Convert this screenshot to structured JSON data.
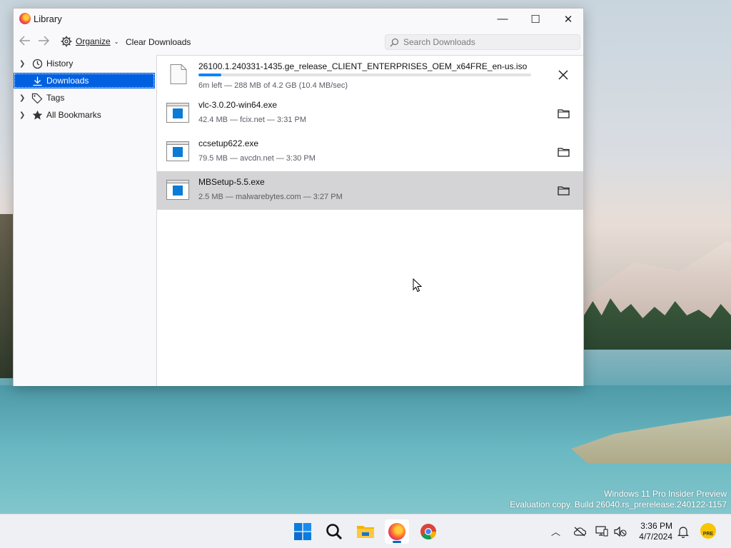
{
  "window": {
    "title": "Library",
    "minimize_glyph": "—",
    "maximize_glyph": "☐",
    "close_glyph": "✕"
  },
  "toolbar": {
    "organize_label": "Organize",
    "clear_label": "Clear Downloads",
    "search_placeholder": "Search Downloads"
  },
  "sidebar": {
    "items": [
      {
        "label": "History",
        "icon": "clock-icon",
        "selected": false
      },
      {
        "label": "Downloads",
        "icon": "download-icon",
        "selected": true
      },
      {
        "label": "Tags",
        "icon": "tag-icon",
        "selected": false
      },
      {
        "label": "All Bookmarks",
        "icon": "star-icon",
        "selected": false
      }
    ]
  },
  "downloads": [
    {
      "name": "26100.1.240331-1435.ge_release_CLIENT_ENTERPRISES_OEM_x64FRE_en-us.iso",
      "status": "6m left — 288 MB of 4.2 GB (10.4 MB/sec)",
      "progress": 0.068,
      "action": "cancel-icon",
      "in_progress": true
    },
    {
      "name": "vlc-3.0.20-win64.exe",
      "status": "42.4 MB — fcix.net — 3:31 PM",
      "action": "folder-icon"
    },
    {
      "name": "ccsetup622.exe",
      "status": "79.5 MB — avcdn.net — 3:30 PM",
      "action": "folder-icon"
    },
    {
      "name": "MBSetup-5.5.exe",
      "status": "2.5 MB — malwarebytes.com — 3:27 PM",
      "action": "folder-icon",
      "hovered": true
    }
  ],
  "desktop": {
    "watermark_line1": "Windows 11 Pro Insider Preview",
    "watermark_line2": "Evaluation copy. Build 26040.rs_prerelease.240122-1157"
  },
  "taskbar": {
    "apps": [
      "windows-start-icon",
      "search-icon",
      "file-explorer-icon",
      "firefox-icon",
      "chrome-icon"
    ],
    "active_app": "firefox-icon",
    "clock_time": "3:36 PM",
    "clock_date": "4/7/2024",
    "tray_badge": "PRE"
  },
  "colors": {
    "accent": "#0060df",
    "progress": "#0a84ff",
    "hover_row": "#d4d4d6"
  }
}
